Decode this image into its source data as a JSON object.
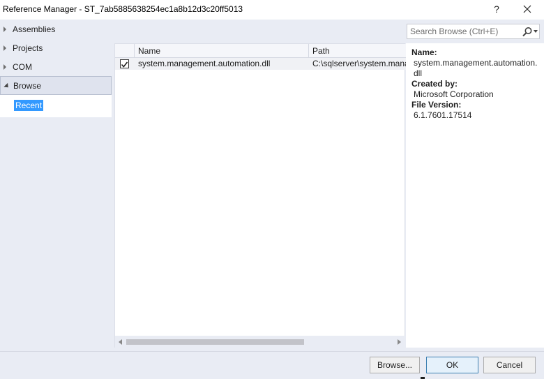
{
  "window": {
    "title": "Reference Manager - ST_7ab5885638254ec1a8b12d3c20ff5013",
    "help_label": "?"
  },
  "nav": {
    "items": [
      {
        "label": "Assemblies"
      },
      {
        "label": "Projects"
      },
      {
        "label": "COM"
      },
      {
        "label": "Browse"
      }
    ],
    "sub_item": "Recent"
  },
  "search": {
    "placeholder": "Search Browse (Ctrl+E)"
  },
  "grid": {
    "columns": [
      "Name",
      "Path"
    ],
    "rows": [
      {
        "checked": true,
        "name": "system.management.automation.dll",
        "path": "C:\\sqlserver\\system.mana"
      }
    ]
  },
  "details": {
    "name_label": "Name:",
    "name_value": "system.management.automation.dll",
    "created_label": "Created by:",
    "created_value": "Microsoft Corporation",
    "version_label": "File Version:",
    "version_value": "6.1.7601.17514"
  },
  "footer": {
    "browse_label": "Browse...",
    "ok_label": "OK",
    "cancel_label": "Cancel"
  },
  "colors": {
    "accent_selection": "#3399ff",
    "panel_background": "#e9ecf4"
  }
}
